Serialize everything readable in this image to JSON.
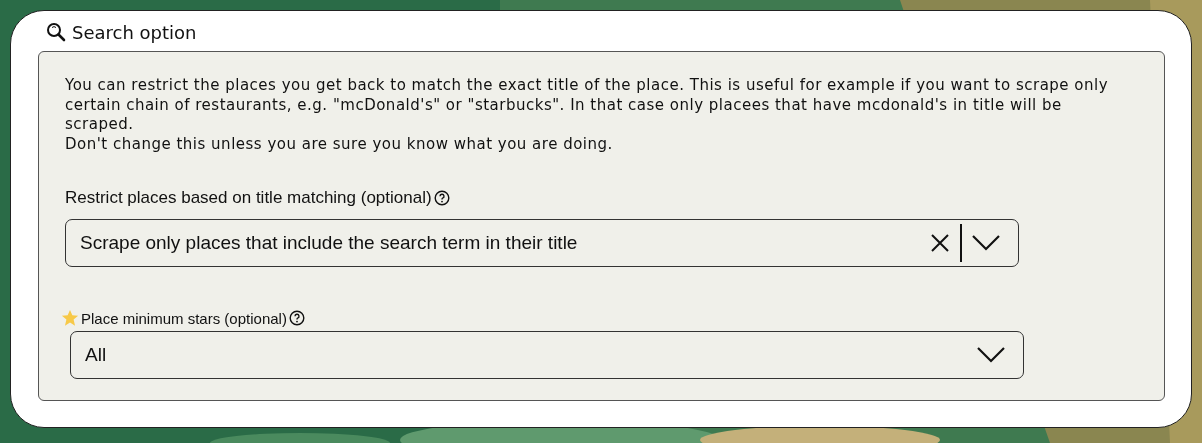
{
  "title": "Search option",
  "description": "You can restrict the places you get back to match the exact title of the place. This is useful for example if you want to scrape only certain chain of restaurants, e.g. \"mcDonald's\" or \"starbucks\". In that case only placees that have mcdonald's in title will be scraped.\n Don't change this unless you are sure you know what you are doing.",
  "fields": [
    {
      "kind": "large",
      "label": "Restrict places based on title matching (optional)",
      "value": "Scrape only places that include the search term in their title",
      "clearable": true,
      "starred": false
    },
    {
      "kind": "small",
      "label": "Place minimum stars (optional)",
      "value": "All",
      "clearable": false,
      "starred": true
    }
  ]
}
